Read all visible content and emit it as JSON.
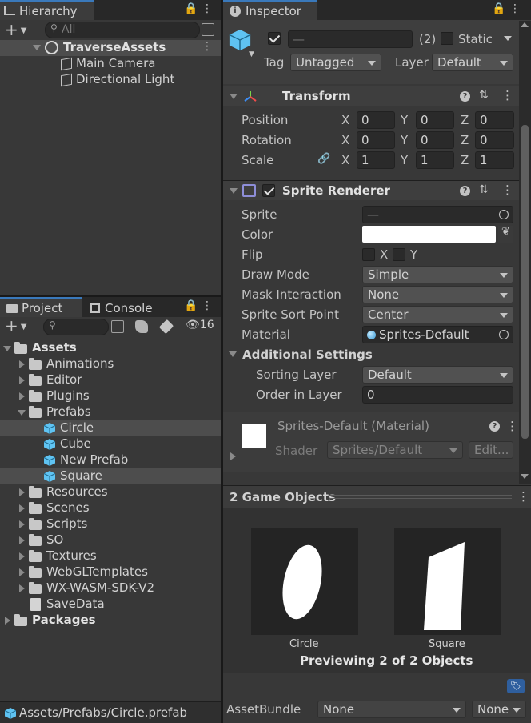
{
  "hierarchy": {
    "tab_label": "Hierarchy",
    "search_placeholder": "All",
    "scene_name": "TraverseAssets",
    "children": [
      "Main Camera",
      "Directional Light"
    ]
  },
  "inspector": {
    "tab_label": "Inspector",
    "name_value": "—",
    "count_label": "(2)",
    "static_label": "Static",
    "tag_label": "Tag",
    "tag_value": "Untagged",
    "layer_label": "Layer",
    "layer_value": "Default",
    "transform": {
      "title": "Transform",
      "rows": [
        {
          "label": "Position",
          "x": "0",
          "y": "0",
          "z": "0"
        },
        {
          "label": "Rotation",
          "x": "0",
          "y": "0",
          "z": "0"
        },
        {
          "label": "Scale",
          "x": "1",
          "y": "1",
          "z": "1"
        }
      ],
      "axis_x": "X",
      "axis_y": "Y",
      "axis_z": "Z"
    },
    "sprite_renderer": {
      "title": "Sprite Renderer",
      "sprite_label": "Sprite",
      "sprite_value": "—",
      "color_label": "Color",
      "color_value": "#ffffff",
      "flip_label": "Flip",
      "flip_x": "X",
      "flip_y": "Y",
      "draw_mode_label": "Draw Mode",
      "draw_mode_value": "Simple",
      "mask_label": "Mask Interaction",
      "mask_value": "None",
      "sort_point_label": "Sprite Sort Point",
      "sort_point_value": "Center",
      "material_label": "Material",
      "material_value": "Sprites-Default",
      "additional_label": "Additional Settings",
      "sorting_layer_label": "Sorting Layer",
      "sorting_layer_value": "Default",
      "order_label": "Order in Layer",
      "order_value": "0"
    },
    "material": {
      "title": "Sprites-Default (Material)",
      "shader_label": "Shader",
      "shader_value": "Sprites/Default",
      "edit_label": "Edit..."
    },
    "preview": {
      "title": "2 Game Objects",
      "items": [
        "Circle",
        "Square"
      ],
      "caption": "Previewing 2 of 2 Objects"
    },
    "asset_bundle": {
      "label": "AssetBundle",
      "name_value": "None",
      "variant_value": "None"
    }
  },
  "project": {
    "tab_project": "Project",
    "tab_console": "Console",
    "hidden_count": "16",
    "tree": [
      {
        "label": "Assets",
        "depth": 0,
        "type": "folder",
        "open": true,
        "bold": true
      },
      {
        "label": "Animations",
        "depth": 1,
        "type": "folder"
      },
      {
        "label": "Editor",
        "depth": 1,
        "type": "folder"
      },
      {
        "label": "Plugins",
        "depth": 1,
        "type": "folder"
      },
      {
        "label": "Prefabs",
        "depth": 1,
        "type": "folder",
        "open": true
      },
      {
        "label": "Circle",
        "depth": 2,
        "type": "prefab",
        "selected": true
      },
      {
        "label": "Cube",
        "depth": 2,
        "type": "prefab"
      },
      {
        "label": "New Prefab",
        "depth": 2,
        "type": "prefab"
      },
      {
        "label": "Square",
        "depth": 2,
        "type": "prefab",
        "selected": true
      },
      {
        "label": "Resources",
        "depth": 1,
        "type": "folder"
      },
      {
        "label": "Scenes",
        "depth": 1,
        "type": "folder"
      },
      {
        "label": "Scripts",
        "depth": 1,
        "type": "folder"
      },
      {
        "label": "SO",
        "depth": 1,
        "type": "folder"
      },
      {
        "label": "Textures",
        "depth": 1,
        "type": "folder"
      },
      {
        "label": "WebGLTemplates",
        "depth": 1,
        "type": "folder"
      },
      {
        "label": "WX-WASM-SDK-V2",
        "depth": 1,
        "type": "folder"
      },
      {
        "label": "SaveData",
        "depth": 1,
        "type": "file"
      },
      {
        "label": "Packages",
        "depth": 0,
        "type": "folder",
        "bold": true
      }
    ],
    "status_path": "Assets/Prefabs/Circle.prefab"
  },
  "colors": {
    "accent": "#3a79bb",
    "prefab": "#5fc3f2",
    "panel": "#383838",
    "selected_row": "#4d4d4d"
  }
}
